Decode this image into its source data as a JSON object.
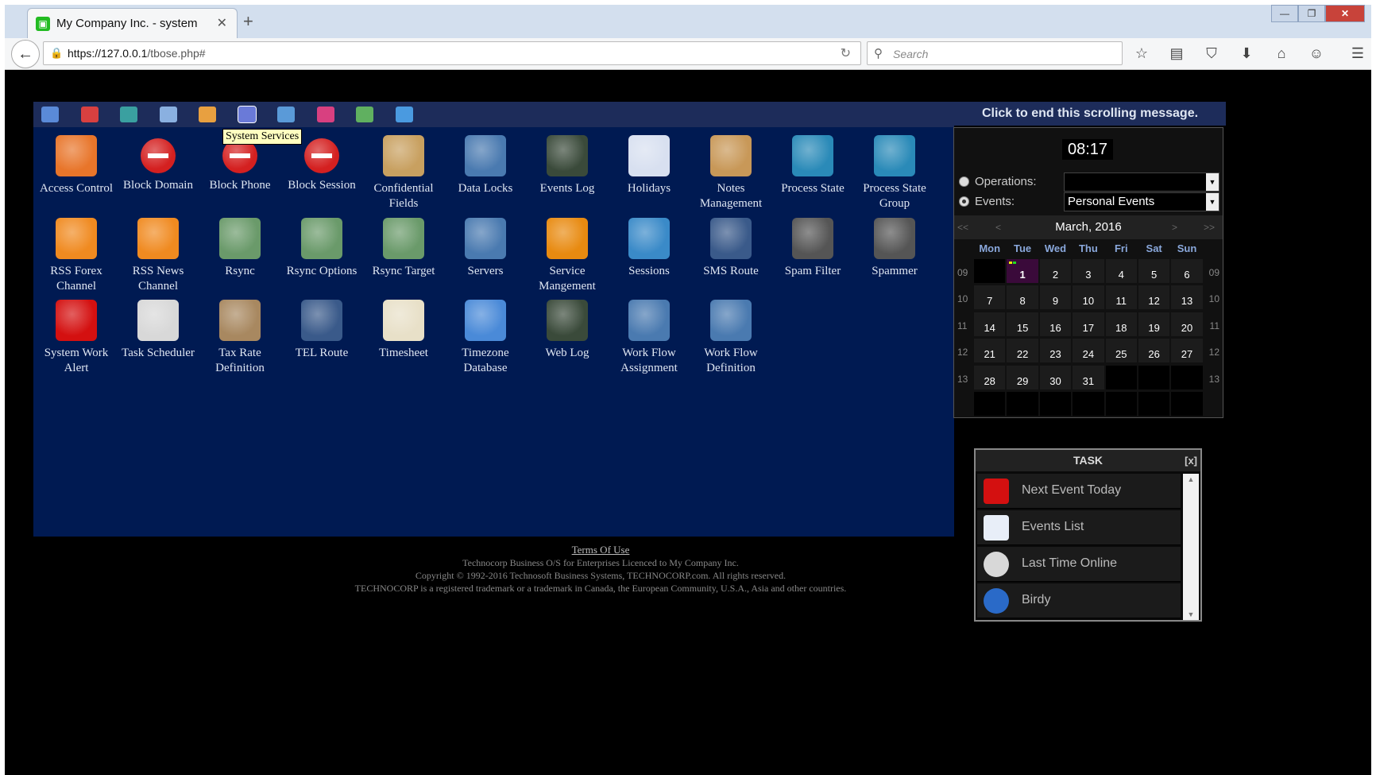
{
  "browser": {
    "tab_title": "My Company Inc. - system",
    "tab_close": "✕",
    "new_tab": "+",
    "url_host": "https://127.0.0.1",
    "url_path": "/tbose.php#",
    "search_placeholder": "Search"
  },
  "toolbar": {
    "tooltip": "System Services",
    "buttons": [
      "toolbar-button-1",
      "toolbar-button-2",
      "toolbar-button-3",
      "toolbar-button-4",
      "toolbar-button-5",
      "toolbar-button-system-services",
      "toolbar-button-7",
      "toolbar-button-8",
      "toolbar-button-9",
      "toolbar-button-10"
    ]
  },
  "apps": [
    {
      "label": "Access Control",
      "icon": "firewall-icon",
      "color": "#e8752a"
    },
    {
      "label": "Block Domain",
      "icon": "no-entry-icon",
      "color": "#d42020"
    },
    {
      "label": "Block Phone",
      "icon": "no-entry-icon",
      "color": "#d42020"
    },
    {
      "label": "Block Session",
      "icon": "no-entry-icon",
      "color": "#d42020"
    },
    {
      "label": "Confidential Fields",
      "icon": "fields-list-icon",
      "color": "#c8a060"
    },
    {
      "label": "Data Locks",
      "icon": "data-lock-icon",
      "color": "#4a7ab0"
    },
    {
      "label": "Events Log",
      "icon": "monitor-icon",
      "color": "#3a4a3a"
    },
    {
      "label": "Holidays",
      "icon": "calendar-icon",
      "color": "#d8e0f0"
    },
    {
      "label": "Notes Management",
      "icon": "folder-notes-icon",
      "color": "#c89858"
    },
    {
      "label": "Process State",
      "icon": "process-state-icon",
      "color": "#2a8ab8"
    },
    {
      "label": "Process State Group",
      "icon": "process-group-icon",
      "color": "#2a8ab8"
    },
    {
      "label": "RSS Forex Channel",
      "icon": "rss-icon",
      "color": "#f08a20"
    },
    {
      "label": "RSS News Channel",
      "icon": "rss-icon",
      "color": "#f08a20"
    },
    {
      "label": "Rsync",
      "icon": "rsync-icon",
      "color": "#6a9a6a"
    },
    {
      "label": "Rsync Options",
      "icon": "rsync-icon",
      "color": "#6a9a6a"
    },
    {
      "label": "Rsync Target",
      "icon": "rsync-icon",
      "color": "#6a9a6a"
    },
    {
      "label": "Servers",
      "icon": "servers-icon",
      "color": "#4a7ab0"
    },
    {
      "label": "Service Mangement",
      "icon": "gear-icon",
      "color": "#e88a10"
    },
    {
      "label": "Sessions",
      "icon": "globe-icon",
      "color": "#3a8ac8"
    },
    {
      "label": "SMS Route",
      "icon": "sms-route-icon",
      "color": "#3a5a8a"
    },
    {
      "label": "Spam Filter",
      "icon": "spy-icon",
      "color": "#555"
    },
    {
      "label": "Spammer",
      "icon": "spy-icon",
      "color": "#555"
    },
    {
      "label": "System Work Alert",
      "icon": "alert-burst-icon",
      "color": "#d41010"
    },
    {
      "label": "Task Scheduler",
      "icon": "clock-icon",
      "color": "#d8d8d8"
    },
    {
      "label": "Tax Rate Definition",
      "icon": "tax-percent-icon",
      "color": "#a88860"
    },
    {
      "label": "TEL Route",
      "icon": "tel-route-icon",
      "color": "#3a5a8a"
    },
    {
      "label": "Timesheet",
      "icon": "timesheet-icon",
      "color": "#e8e0c8"
    },
    {
      "label": "Timezone Database",
      "icon": "globe-icon",
      "color": "#4a8ad8"
    },
    {
      "label": "Web Log",
      "icon": "monitor-icon",
      "color": "#3a4a3a"
    },
    {
      "label": "Work Flow Assignment",
      "icon": "workflow-assign-icon",
      "color": "#4a7ab0"
    },
    {
      "label": "Work Flow Definition",
      "icon": "workflow-icon",
      "color": "#4a7ab0"
    }
  ],
  "scroll_message": "Click to end this scrolling message.",
  "clock": "08:17",
  "filters": {
    "operations_label": "Operations:",
    "operations_value": "",
    "events_label": "Events:",
    "events_value": "Personal Events"
  },
  "calendar": {
    "month": "March, 2016",
    "nav_prev_year": "<<",
    "nav_prev": "<",
    "nav_next": ">",
    "nav_next_year": ">>",
    "days_of_week": [
      "Mon",
      "Tue",
      "Wed",
      "Thu",
      "Fri",
      "Sat",
      "Sun"
    ],
    "week_numbers": [
      "09",
      "10",
      "11",
      "12",
      "13"
    ],
    "weeks": [
      [
        "",
        "1",
        "2",
        "3",
        "4",
        "5",
        "6"
      ],
      [
        "7",
        "8",
        "9",
        "10",
        "11",
        "12",
        "13"
      ],
      [
        "14",
        "15",
        "16",
        "17",
        "18",
        "19",
        "20"
      ],
      [
        "21",
        "22",
        "23",
        "24",
        "25",
        "26",
        "27"
      ],
      [
        "28",
        "29",
        "30",
        "31",
        "",
        "",
        ""
      ],
      [
        "",
        "",
        "",
        "",
        "",
        "",
        ""
      ]
    ],
    "today": "1"
  },
  "footer": {
    "terms": "Terms Of Use",
    "line1": "Technocorp Business O/S for Enterprises Licenced to My Company Inc.",
    "line2": "Copyright © 1992-2016 Technosoft Business Systems, TECHNOCORP.com.  All rights reserved.",
    "line3": "TECHNOCORP is a registered trademark or a trademark in Canada, the European Community, U.S.A., Asia and other countries."
  },
  "task": {
    "title": "TASK",
    "close": "[x]",
    "items": [
      {
        "label": "Next Event Today",
        "icon": "alert-burst-icon",
        "color": "#d41010"
      },
      {
        "label": "Events List",
        "icon": "list-icon",
        "color": "#e8eef8"
      },
      {
        "label": "Last Time Online",
        "icon": "clock-icon",
        "color": "#d8d8d8"
      },
      {
        "label": "Birdy",
        "icon": "bird-icon",
        "color": "#2a6ac8"
      }
    ]
  }
}
